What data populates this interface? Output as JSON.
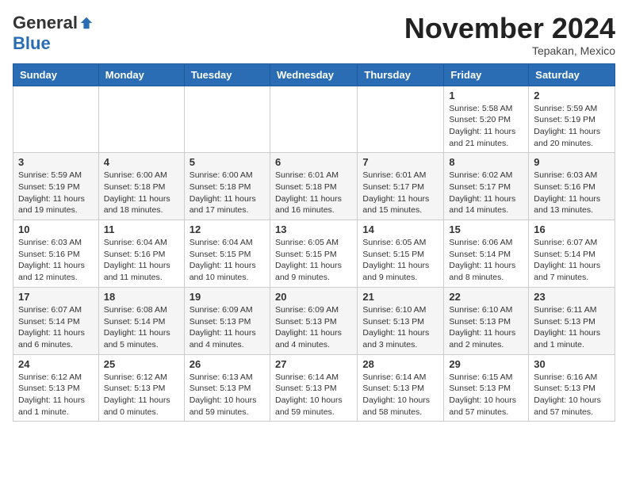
{
  "logo": {
    "general": "General",
    "blue": "Blue"
  },
  "header": {
    "month": "November 2024",
    "location": "Tepakan, Mexico"
  },
  "weekdays": [
    "Sunday",
    "Monday",
    "Tuesday",
    "Wednesday",
    "Thursday",
    "Friday",
    "Saturday"
  ],
  "weeks": [
    [
      {
        "day": "",
        "info": ""
      },
      {
        "day": "",
        "info": ""
      },
      {
        "day": "",
        "info": ""
      },
      {
        "day": "",
        "info": ""
      },
      {
        "day": "",
        "info": ""
      },
      {
        "day": "1",
        "info": "Sunrise: 5:58 AM\nSunset: 5:20 PM\nDaylight: 11 hours and 21 minutes."
      },
      {
        "day": "2",
        "info": "Sunrise: 5:59 AM\nSunset: 5:19 PM\nDaylight: 11 hours and 20 minutes."
      }
    ],
    [
      {
        "day": "3",
        "info": "Sunrise: 5:59 AM\nSunset: 5:19 PM\nDaylight: 11 hours and 19 minutes."
      },
      {
        "day": "4",
        "info": "Sunrise: 6:00 AM\nSunset: 5:18 PM\nDaylight: 11 hours and 18 minutes."
      },
      {
        "day": "5",
        "info": "Sunrise: 6:00 AM\nSunset: 5:18 PM\nDaylight: 11 hours and 17 minutes."
      },
      {
        "day": "6",
        "info": "Sunrise: 6:01 AM\nSunset: 5:18 PM\nDaylight: 11 hours and 16 minutes."
      },
      {
        "day": "7",
        "info": "Sunrise: 6:01 AM\nSunset: 5:17 PM\nDaylight: 11 hours and 15 minutes."
      },
      {
        "day": "8",
        "info": "Sunrise: 6:02 AM\nSunset: 5:17 PM\nDaylight: 11 hours and 14 minutes."
      },
      {
        "day": "9",
        "info": "Sunrise: 6:03 AM\nSunset: 5:16 PM\nDaylight: 11 hours and 13 minutes."
      }
    ],
    [
      {
        "day": "10",
        "info": "Sunrise: 6:03 AM\nSunset: 5:16 PM\nDaylight: 11 hours and 12 minutes."
      },
      {
        "day": "11",
        "info": "Sunrise: 6:04 AM\nSunset: 5:16 PM\nDaylight: 11 hours and 11 minutes."
      },
      {
        "day": "12",
        "info": "Sunrise: 6:04 AM\nSunset: 5:15 PM\nDaylight: 11 hours and 10 minutes."
      },
      {
        "day": "13",
        "info": "Sunrise: 6:05 AM\nSunset: 5:15 PM\nDaylight: 11 hours and 9 minutes."
      },
      {
        "day": "14",
        "info": "Sunrise: 6:05 AM\nSunset: 5:15 PM\nDaylight: 11 hours and 9 minutes."
      },
      {
        "day": "15",
        "info": "Sunrise: 6:06 AM\nSunset: 5:14 PM\nDaylight: 11 hours and 8 minutes."
      },
      {
        "day": "16",
        "info": "Sunrise: 6:07 AM\nSunset: 5:14 PM\nDaylight: 11 hours and 7 minutes."
      }
    ],
    [
      {
        "day": "17",
        "info": "Sunrise: 6:07 AM\nSunset: 5:14 PM\nDaylight: 11 hours and 6 minutes."
      },
      {
        "day": "18",
        "info": "Sunrise: 6:08 AM\nSunset: 5:14 PM\nDaylight: 11 hours and 5 minutes."
      },
      {
        "day": "19",
        "info": "Sunrise: 6:09 AM\nSunset: 5:13 PM\nDaylight: 11 hours and 4 minutes."
      },
      {
        "day": "20",
        "info": "Sunrise: 6:09 AM\nSunset: 5:13 PM\nDaylight: 11 hours and 4 minutes."
      },
      {
        "day": "21",
        "info": "Sunrise: 6:10 AM\nSunset: 5:13 PM\nDaylight: 11 hours and 3 minutes."
      },
      {
        "day": "22",
        "info": "Sunrise: 6:10 AM\nSunset: 5:13 PM\nDaylight: 11 hours and 2 minutes."
      },
      {
        "day": "23",
        "info": "Sunrise: 6:11 AM\nSunset: 5:13 PM\nDaylight: 11 hours and 1 minute."
      }
    ],
    [
      {
        "day": "24",
        "info": "Sunrise: 6:12 AM\nSunset: 5:13 PM\nDaylight: 11 hours and 1 minute."
      },
      {
        "day": "25",
        "info": "Sunrise: 6:12 AM\nSunset: 5:13 PM\nDaylight: 11 hours and 0 minutes."
      },
      {
        "day": "26",
        "info": "Sunrise: 6:13 AM\nSunset: 5:13 PM\nDaylight: 10 hours and 59 minutes."
      },
      {
        "day": "27",
        "info": "Sunrise: 6:14 AM\nSunset: 5:13 PM\nDaylight: 10 hours and 59 minutes."
      },
      {
        "day": "28",
        "info": "Sunrise: 6:14 AM\nSunset: 5:13 PM\nDaylight: 10 hours and 58 minutes."
      },
      {
        "day": "29",
        "info": "Sunrise: 6:15 AM\nSunset: 5:13 PM\nDaylight: 10 hours and 57 minutes."
      },
      {
        "day": "30",
        "info": "Sunrise: 6:16 AM\nSunset: 5:13 PM\nDaylight: 10 hours and 57 minutes."
      }
    ]
  ]
}
